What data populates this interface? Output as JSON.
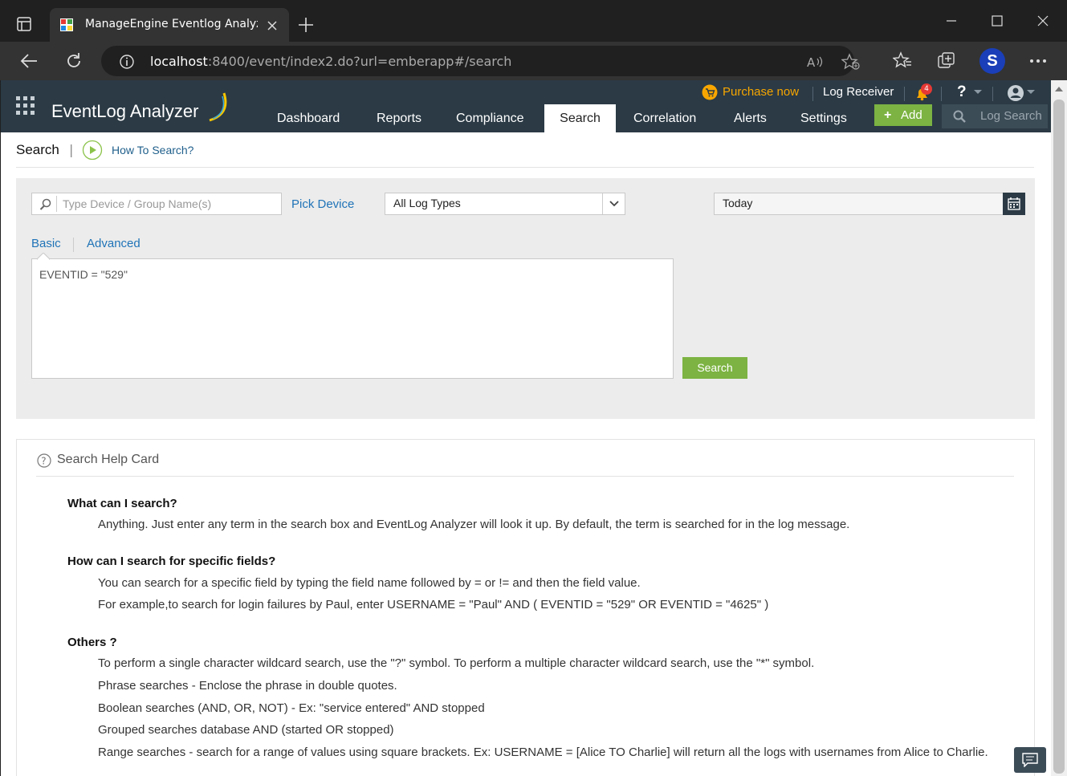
{
  "browser": {
    "tab_title": "ManageEngine Eventlog Analyzer",
    "url_host": "localhost",
    "url_rest": ":8400/event/index2.do?url=emberapp#/search",
    "profile_letter": "S"
  },
  "header": {
    "logo_text": "EventLog Analyzer",
    "purchase_label": "Purchase now",
    "log_receiver_label": "Log Receiver",
    "notification_count": "4",
    "help_label": "?",
    "add_label": "Add",
    "log_search_label": "Log Search",
    "nav": [
      "Dashboard",
      "Reports",
      "Compliance",
      "Search",
      "Correlation",
      "Alerts",
      "Settings"
    ],
    "active_nav": "Search"
  },
  "page": {
    "title": "Search",
    "how_to_label": "How To Search?"
  },
  "search_form": {
    "device_placeholder": "Type Device / Group Name(s)",
    "pick_device_label": "Pick Device",
    "log_type_value": "All Log Types",
    "date_value": "Today",
    "tab_basic": "Basic",
    "tab_advanced": "Advanced",
    "query_value": "EVENTID = \"529\"",
    "search_button": "Search"
  },
  "help_card": {
    "title": "Search Help Card",
    "q1": "What can I search?",
    "a1": "Anything. Just enter any term in the search box and EventLog Analyzer will look it up. By default, the term is searched for in the log message.",
    "q2": "How can I search for specific fields?",
    "a2_1": "You can search for a specific field by typing the field name followed by = or != and then the field value.",
    "a2_2": "For example,to search for login failures by Paul, enter USERNAME = \"Paul\" AND ( EVENTID = \"529\" OR EVENTID = \"4625\" )",
    "q3": "Others ?",
    "a3_1": "To perform a single character wildcard search, use the \"?\" symbol. To perform a multiple character wildcard search, use the \"*\" symbol.",
    "a3_2": "Phrase searches - Enclose the phrase in double quotes.",
    "a3_3": "Boolean searches (AND, OR, NOT) - Ex: \"service entered\" AND stopped",
    "a3_4": "Grouped searches database AND (started OR stopped)",
    "a3_5": "Range searches - search for a range of values using square brackets. Ex: USERNAME = [Alice TO Charlie] will return all the logs with usernames from Alice to Charlie."
  },
  "colors": {
    "header_bg": "#2b3a45",
    "accent_green": "#7cb342",
    "link_blue": "#1f73b7",
    "purchase_orange": "#f7a600"
  }
}
